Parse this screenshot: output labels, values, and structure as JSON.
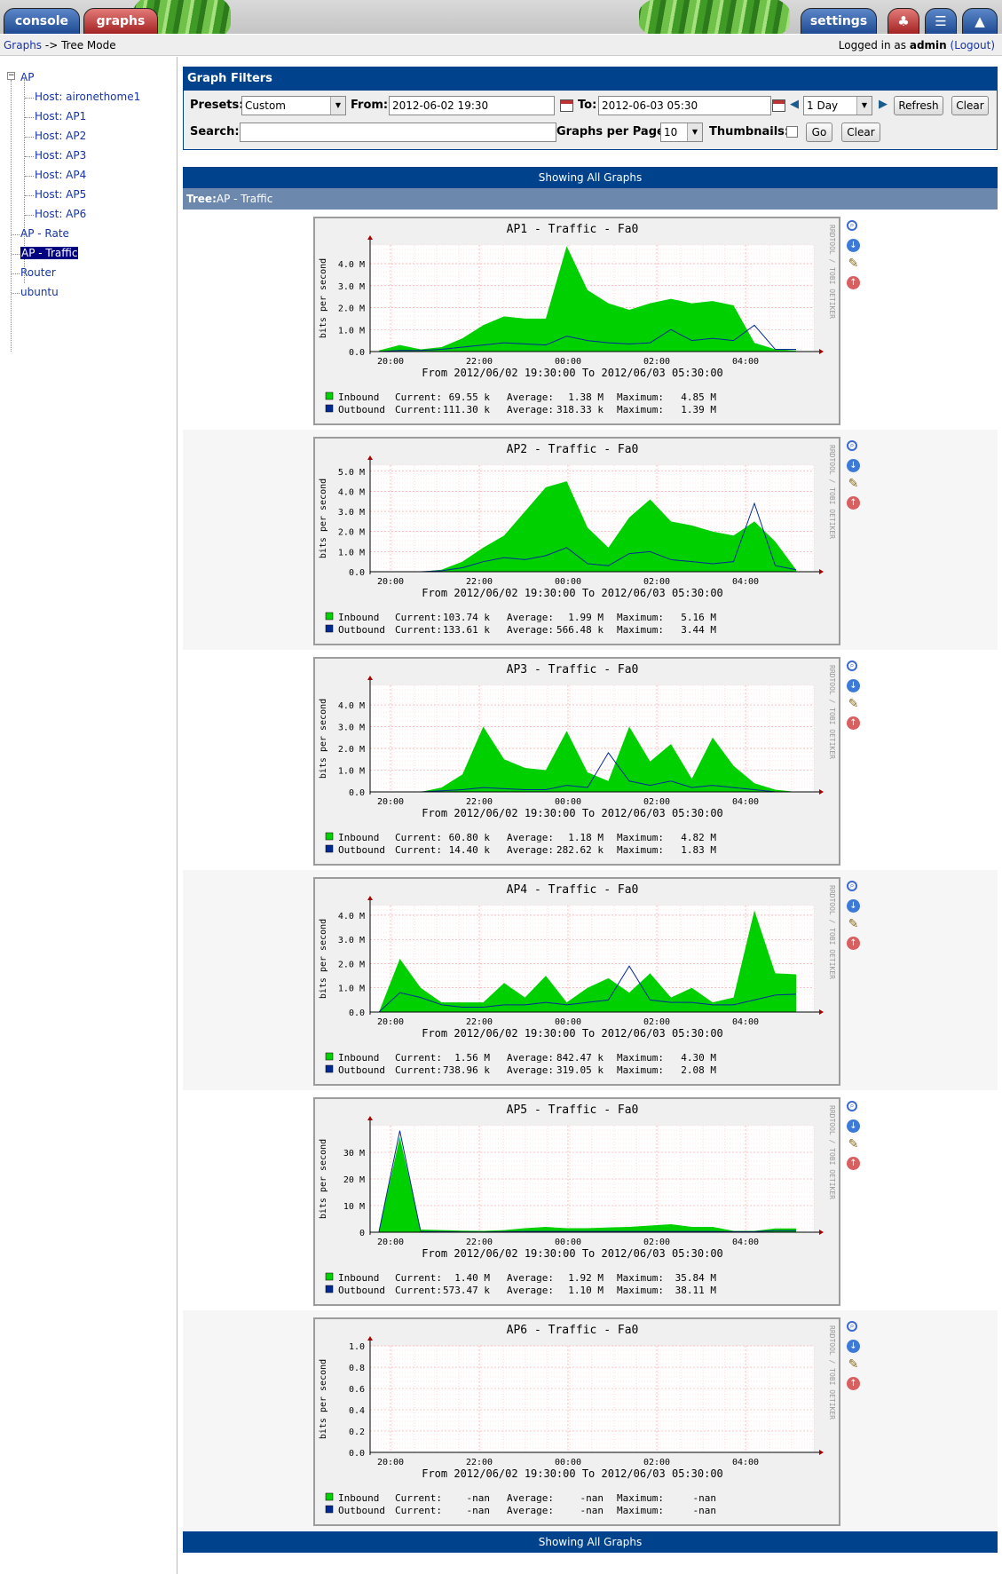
{
  "header": {
    "tabs": [
      "console",
      "graphs",
      "settings"
    ],
    "icon_tabs": [
      "tree-icon",
      "list-icon",
      "preview-icon"
    ]
  },
  "breadcrumb": {
    "root": "Graphs",
    "separator": "->",
    "current": "Tree Mode"
  },
  "login": {
    "prefix": "Logged in as",
    "user": "admin",
    "logout": "(Logout)"
  },
  "tree": {
    "root": "AP",
    "hosts": [
      "Host: aironethome1",
      "Host: AP1",
      "Host: AP2",
      "Host: AP3",
      "Host: AP4",
      "Host: AP5",
      "Host: AP6"
    ],
    "others": [
      "AP - Rate",
      "AP - Traffic",
      "Router",
      "ubuntu"
    ],
    "selected": "AP - Traffic"
  },
  "filters": {
    "title": "Graph Filters",
    "presets_label": "Presets:",
    "presets_value": "Custom",
    "from_label": "From:",
    "from_value": "2012-06-02 19:30",
    "to_label": "To:",
    "to_value": "2012-06-03 05:30",
    "timespan_value": "1 Day",
    "refresh": "Refresh",
    "clear": "Clear",
    "search_label": "Search:",
    "search_value": "",
    "per_page_label": "Graphs per Page:",
    "per_page_value": "10",
    "thumbnails_label": "Thumbnails:",
    "go": "Go",
    "clear2": "Clear"
  },
  "showing_all": "Showing All Graphs",
  "tree_heading": {
    "prefix": "Tree:",
    "name": "AP - Traffic"
  },
  "graph_common": {
    "ylabel": "bits per second",
    "xticks": [
      "20:00",
      "22:00",
      "00:00",
      "02:00",
      "04:00"
    ],
    "from_to": "From 2012/06/02 19:30:00 To 2012/06/03 05:30:00",
    "watermark": "RRDTOOL / TOBI OETIKER",
    "colors": {
      "inbound": "#00cf00",
      "outbound": "#002a97",
      "grid": "#ff9999"
    }
  },
  "graphs": [
    {
      "title": "AP1 - Traffic - Fa0",
      "yticks": [
        "0.0",
        "1.0 M",
        "2.0 M",
        "3.0 M",
        "4.0 M"
      ],
      "legend": [
        {
          "name": "Inbound",
          "current": "69.55 k",
          "average": "1.38 M",
          "maximum": "4.85 M"
        },
        {
          "name": "Outbound",
          "current": "111.30 k",
          "average": "318.33 k",
          "maximum": "1.39 M"
        }
      ]
    },
    {
      "title": "AP2 - Traffic - Fa0",
      "yticks": [
        "0.0",
        "1.0 M",
        "2.0 M",
        "3.0 M",
        "4.0 M",
        "5.0 M"
      ],
      "legend": [
        {
          "name": "Inbound",
          "current": "103.74 k",
          "average": "1.99 M",
          "maximum": "5.16 M"
        },
        {
          "name": "Outbound",
          "current": "133.61 k",
          "average": "566.48 k",
          "maximum": "3.44 M"
        }
      ]
    },
    {
      "title": "AP3 - Traffic - Fa0",
      "yticks": [
        "0.0",
        "1.0 M",
        "2.0 M",
        "3.0 M",
        "4.0 M"
      ],
      "legend": [
        {
          "name": "Inbound",
          "current": "60.80 k",
          "average": "1.18 M",
          "maximum": "4.82 M"
        },
        {
          "name": "Outbound",
          "current": "14.40 k",
          "average": "282.62 k",
          "maximum": "1.83 M"
        }
      ]
    },
    {
      "title": "AP4 - Traffic - Fa0",
      "yticks": [
        "0.0",
        "1.0 M",
        "2.0 M",
        "3.0 M",
        "4.0 M"
      ],
      "legend": [
        {
          "name": "Inbound",
          "current": "1.56 M",
          "average": "842.47 k",
          "maximum": "4.30 M"
        },
        {
          "name": "Outbound",
          "current": "738.96 k",
          "average": "319.05 k",
          "maximum": "2.08 M"
        }
      ]
    },
    {
      "title": "AP5 - Traffic - Fa0",
      "yticks": [
        "0",
        "10 M",
        "20 M",
        "30 M"
      ],
      "legend": [
        {
          "name": "Inbound",
          "current": "1.40 M",
          "average": "1.92 M",
          "maximum": "35.84 M"
        },
        {
          "name": "Outbound",
          "current": "573.47 k",
          "average": "1.10 M",
          "maximum": "38.11 M"
        }
      ]
    },
    {
      "title": "AP6 - Traffic - Fa0",
      "yticks": [
        "0.0",
        "0.2",
        "0.4",
        "0.6",
        "0.8",
        "1.0"
      ],
      "legend": [
        {
          "name": "Inbound",
          "current": "-nan",
          "average": "-nan",
          "maximum": "-nan"
        },
        {
          "name": "Outbound",
          "current": "-nan",
          "average": "-nan",
          "maximum": "-nan"
        }
      ]
    }
  ],
  "chart_data": [
    {
      "type": "area",
      "title": "AP1 - Traffic - Fa0",
      "ylabel": "bits per second",
      "unit": "M",
      "x": [
        "19:30",
        "20:00",
        "20:30",
        "21:00",
        "21:30",
        "22:00",
        "22:30",
        "23:00",
        "23:30",
        "00:00",
        "00:30",
        "01:00",
        "01:30",
        "02:00",
        "02:30",
        "03:00",
        "03:30",
        "04:00",
        "04:30",
        "05:00",
        "05:30"
      ],
      "series": [
        {
          "name": "Inbound",
          "values": [
            0.05,
            0.3,
            0.1,
            0.2,
            0.6,
            1.2,
            1.6,
            1.5,
            1.5,
            4.8,
            2.8,
            2.2,
            1.9,
            2.2,
            2.4,
            2.2,
            2.3,
            2.1,
            0.4,
            0.1,
            0.05
          ]
        },
        {
          "name": "Outbound",
          "values": [
            0.0,
            0.05,
            0.05,
            0.1,
            0.2,
            0.3,
            0.4,
            0.35,
            0.3,
            0.7,
            0.5,
            0.4,
            0.35,
            0.4,
            1.0,
            0.5,
            0.6,
            0.5,
            1.2,
            0.1,
            0.1
          ]
        }
      ]
    },
    {
      "type": "area",
      "title": "AP2 - Traffic - Fa0",
      "ylabel": "bits per second",
      "unit": "M",
      "x": [
        "19:30",
        "20:00",
        "20:30",
        "21:00",
        "21:30",
        "22:00",
        "22:30",
        "23:00",
        "23:30",
        "00:00",
        "00:30",
        "01:00",
        "01:30",
        "02:00",
        "02:30",
        "03:00",
        "03:30",
        "04:00",
        "04:30",
        "05:00",
        "05:30"
      ],
      "series": [
        {
          "name": "Inbound",
          "values": [
            0,
            0,
            0,
            0.1,
            0.5,
            1.2,
            1.8,
            3.0,
            4.2,
            4.5,
            2.2,
            1.2,
            2.7,
            3.6,
            2.5,
            2.3,
            2.0,
            1.8,
            2.5,
            1.5,
            0.1
          ]
        },
        {
          "name": "Outbound",
          "values": [
            0,
            0,
            0,
            0.05,
            0.2,
            0.5,
            0.7,
            0.6,
            0.8,
            1.2,
            0.4,
            0.3,
            0.9,
            1.0,
            0.6,
            0.5,
            0.4,
            0.5,
            3.4,
            0.3,
            0.1
          ]
        }
      ]
    },
    {
      "type": "area",
      "title": "AP3 - Traffic - Fa0",
      "ylabel": "bits per second",
      "unit": "M",
      "x": [
        "19:30",
        "20:00",
        "20:30",
        "21:00",
        "21:30",
        "22:00",
        "22:30",
        "23:00",
        "23:30",
        "00:00",
        "00:30",
        "01:00",
        "01:30",
        "02:00",
        "02:30",
        "03:00",
        "03:30",
        "04:00",
        "04:30",
        "05:00",
        "05:30"
      ],
      "series": [
        {
          "name": "Inbound",
          "values": [
            0,
            0,
            0,
            0.2,
            0.8,
            3.0,
            1.5,
            1.1,
            1.0,
            2.8,
            0.9,
            0.5,
            3.0,
            1.4,
            2.2,
            0.6,
            2.5,
            1.2,
            0.4,
            0.1,
            0
          ]
        },
        {
          "name": "Outbound",
          "values": [
            0,
            0,
            0,
            0.05,
            0.1,
            0.2,
            0.15,
            0.1,
            0.1,
            0.3,
            0.2,
            1.8,
            0.5,
            0.3,
            0.5,
            0.2,
            0.3,
            0.2,
            0.1,
            0,
            0
          ]
        }
      ]
    },
    {
      "type": "area",
      "title": "AP4 - Traffic - Fa0",
      "ylabel": "bits per second",
      "unit": "M",
      "x": [
        "19:30",
        "20:00",
        "20:30",
        "21:00",
        "21:30",
        "22:00",
        "22:30",
        "23:00",
        "23:30",
        "00:00",
        "00:30",
        "01:00",
        "01:30",
        "02:00",
        "02:30",
        "03:00",
        "03:30",
        "04:00",
        "04:30",
        "05:00",
        "05:30"
      ],
      "series": [
        {
          "name": "Inbound",
          "values": [
            0,
            2.2,
            1.0,
            0.4,
            0.4,
            0.4,
            1.2,
            0.6,
            1.5,
            0.4,
            1.0,
            1.4,
            0.8,
            1.6,
            0.6,
            1.0,
            0.4,
            0.6,
            4.2,
            1.6,
            1.56
          ]
        },
        {
          "name": "Outbound",
          "values": [
            0,
            0.8,
            0.6,
            0.3,
            0.2,
            0.2,
            0.3,
            0.3,
            0.4,
            0.3,
            0.4,
            0.5,
            1.9,
            0.5,
            0.4,
            0.4,
            0.3,
            0.3,
            0.5,
            0.7,
            0.74
          ]
        }
      ]
    },
    {
      "type": "area",
      "title": "AP5 - Traffic - Fa0",
      "ylabel": "bits per second",
      "unit": "M",
      "x": [
        "19:30",
        "20:00",
        "20:30",
        "21:00",
        "21:30",
        "22:00",
        "22:30",
        "23:00",
        "23:30",
        "00:00",
        "00:30",
        "01:00",
        "01:30",
        "02:00",
        "02:30",
        "03:00",
        "03:30",
        "04:00",
        "04:30",
        "05:00",
        "05:30"
      ],
      "series": [
        {
          "name": "Inbound",
          "values": [
            0.5,
            35.8,
            1.0,
            0.8,
            0.6,
            0.5,
            0.8,
            1.5,
            2.0,
            1.5,
            1.5,
            1.8,
            2.0,
            2.5,
            3.0,
            2.0,
            2.0,
            0.5,
            0.5,
            1.4,
            1.4
          ]
        },
        {
          "name": "Outbound",
          "values": [
            0.2,
            38.1,
            0.2,
            0.2,
            0.1,
            0.1,
            0.2,
            0.3,
            0.3,
            0.3,
            0.3,
            0.3,
            0.3,
            0.3,
            0.3,
            0.3,
            0.3,
            0.2,
            0.2,
            0.6,
            0.6
          ]
        }
      ]
    },
    {
      "type": "area",
      "title": "AP6 - Traffic - Fa0",
      "ylabel": "bits per second",
      "x": [
        "19:30",
        "20:00",
        "20:30",
        "21:00",
        "21:30",
        "22:00",
        "22:30",
        "23:00",
        "23:30",
        "00:00",
        "00:30",
        "01:00",
        "01:30",
        "02:00",
        "02:30",
        "03:00",
        "03:30",
        "04:00",
        "04:30",
        "05:00",
        "05:30"
      ],
      "series": [
        {
          "name": "Inbound",
          "values": []
        },
        {
          "name": "Outbound",
          "values": []
        }
      ]
    }
  ]
}
